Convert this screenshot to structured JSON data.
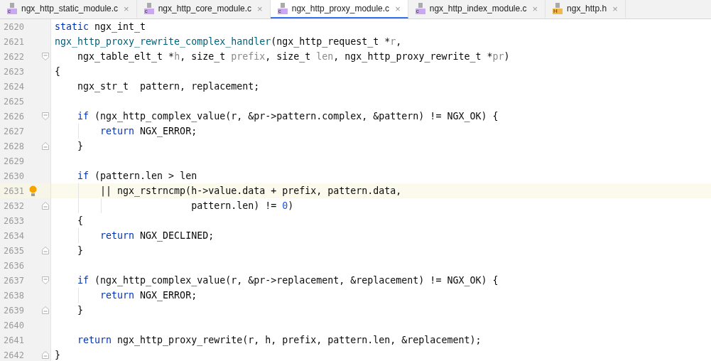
{
  "tabs": [
    {
      "label": "ngx_http_static_module.c",
      "kind": "c",
      "badge": "c",
      "close": "×",
      "selected": false
    },
    {
      "label": "ngx_http_core_module.c",
      "kind": "c",
      "badge": "c",
      "close": "×",
      "selected": false
    },
    {
      "label": "ngx_http_proxy_module.c",
      "kind": "c",
      "badge": "c",
      "close": "×",
      "selected": true
    },
    {
      "label": "ngx_http_index_module.c",
      "kind": "c",
      "badge": "c",
      "close": "×",
      "selected": false
    },
    {
      "label": "ngx_http.h",
      "kind": "h",
      "badge": "H",
      "close": "×",
      "selected": false
    }
  ],
  "lines": [
    {
      "number": "2620",
      "fold_open": false,
      "fold_close": false,
      "current": false,
      "bulb": false,
      "tokens": [
        {
          "kind": "kw",
          "text": "static"
        },
        {
          "kind": "plain",
          "text": " ngx_int_t"
        }
      ]
    },
    {
      "number": "2621",
      "fold_open": false,
      "fold_close": false,
      "current": false,
      "bulb": false,
      "tokens": [
        {
          "kind": "fn",
          "text": "ngx_http_proxy_rewrite_complex_handler"
        },
        {
          "kind": "plain",
          "text": "(ngx_http_request_t *"
        },
        {
          "kind": "param",
          "text": "r"
        },
        {
          "kind": "plain",
          "text": ","
        }
      ]
    },
    {
      "number": "2622",
      "fold_open": true,
      "fold_close": false,
      "current": false,
      "bulb": false,
      "tokens": [
        {
          "kind": "plain",
          "text": "    ngx_table_elt_t *"
        },
        {
          "kind": "param",
          "text": "h"
        },
        {
          "kind": "plain",
          "text": ", size_t "
        },
        {
          "kind": "param",
          "text": "prefix"
        },
        {
          "kind": "plain",
          "text": ", size_t "
        },
        {
          "kind": "param",
          "text": "len"
        },
        {
          "kind": "plain",
          "text": ", ngx_http_proxy_rewrite_t *"
        },
        {
          "kind": "param",
          "text": "pr"
        },
        {
          "kind": "plain",
          "text": ")"
        }
      ]
    },
    {
      "number": "2623",
      "fold_open": false,
      "fold_close": false,
      "current": false,
      "bulb": false,
      "tokens": [
        {
          "kind": "plain",
          "text": "{"
        }
      ]
    },
    {
      "number": "2624",
      "fold_open": false,
      "fold_close": false,
      "current": false,
      "bulb": false,
      "tokens": [
        {
          "kind": "plain",
          "text": "    ngx_str_t  pattern, replacement;"
        }
      ]
    },
    {
      "number": "2625",
      "fold_open": false,
      "fold_close": false,
      "current": false,
      "bulb": false
    },
    {
      "number": "2626",
      "fold_open": true,
      "fold_close": false,
      "current": false,
      "bulb": false,
      "tokens": [
        {
          "kind": "kw",
          "text": "    if"
        },
        {
          "kind": "plain",
          "text": " (ngx_http_complex_value(r, &pr->pattern.complex, &pattern) != NGX_OK) {"
        }
      ]
    },
    {
      "number": "2627",
      "fold_open": false,
      "fold_close": false,
      "current": false,
      "bulb": false,
      "tokens": [
        {
          "kind": "kw",
          "text": "        return"
        },
        {
          "kind": "plain",
          "text": " NGX_ERROR;"
        }
      ]
    },
    {
      "number": "2628",
      "fold_open": false,
      "fold_close": true,
      "current": false,
      "bulb": false,
      "tokens": [
        {
          "kind": "plain",
          "text": "    }"
        }
      ]
    },
    {
      "number": "2629",
      "fold_open": false,
      "fold_close": false,
      "current": false,
      "bulb": false
    },
    {
      "number": "2630",
      "fold_open": false,
      "fold_close": false,
      "current": false,
      "bulb": false,
      "tokens": [
        {
          "kind": "kw",
          "text": "    if"
        },
        {
          "kind": "plain",
          "text": " (pattern.len > len"
        }
      ]
    },
    {
      "number": "2631",
      "fold_open": false,
      "fold_close": false,
      "current": true,
      "bulb": true,
      "tokens": [
        {
          "kind": "plain",
          "text": "        || ngx_rstrncmp(h->value.data + prefix, pattern.data,"
        }
      ]
    },
    {
      "number": "2632",
      "fold_open": false,
      "fold_close": true,
      "current": false,
      "bulb": false,
      "tokens": [
        {
          "kind": "plain",
          "text": "                        pattern.len) != "
        },
        {
          "kind": "num",
          "text": "0"
        },
        {
          "kind": "plain",
          "text": ")"
        }
      ]
    },
    {
      "number": "2633",
      "fold_open": false,
      "fold_close": false,
      "current": false,
      "bulb": false,
      "tokens": [
        {
          "kind": "plain",
          "text": "    {"
        }
      ]
    },
    {
      "number": "2634",
      "fold_open": false,
      "fold_close": false,
      "current": false,
      "bulb": false,
      "tokens": [
        {
          "kind": "kw",
          "text": "        return"
        },
        {
          "kind": "plain",
          "text": " NGX_DECLINED;"
        }
      ]
    },
    {
      "number": "2635",
      "fold_open": false,
      "fold_close": true,
      "current": false,
      "bulb": false,
      "tokens": [
        {
          "kind": "plain",
          "text": "    }"
        }
      ]
    },
    {
      "number": "2636",
      "fold_open": false,
      "fold_close": false,
      "current": false,
      "bulb": false
    },
    {
      "number": "2637",
      "fold_open": true,
      "fold_close": false,
      "current": false,
      "bulb": false,
      "tokens": [
        {
          "kind": "kw",
          "text": "    if"
        },
        {
          "kind": "plain",
          "text": " (ngx_http_complex_value(r, &pr->replacement, &replacement) != NGX_OK) {"
        }
      ]
    },
    {
      "number": "2638",
      "fold_open": false,
      "fold_close": false,
      "current": false,
      "bulb": false,
      "tokens": [
        {
          "kind": "kw",
          "text": "        return"
        },
        {
          "kind": "plain",
          "text": " NGX_ERROR;"
        }
      ]
    },
    {
      "number": "2639",
      "fold_open": false,
      "fold_close": true,
      "current": false,
      "bulb": false,
      "tokens": [
        {
          "kind": "plain",
          "text": "    }"
        }
      ]
    },
    {
      "number": "2640",
      "fold_open": false,
      "fold_close": false,
      "current": false,
      "bulb": false
    },
    {
      "number": "2641",
      "fold_open": false,
      "fold_close": false,
      "current": false,
      "bulb": false,
      "tokens": [
        {
          "kind": "kw",
          "text": "    return"
        },
        {
          "kind": "plain",
          "text": " ngx_http_proxy_rewrite(r, h, prefix, pattern.len, &replacement);"
        }
      ]
    },
    {
      "number": "2642",
      "fold_open": false,
      "fold_close": true,
      "current": false,
      "bulb": false,
      "tokens": [
        {
          "kind": "plain",
          "text": "}"
        }
      ]
    }
  ]
}
